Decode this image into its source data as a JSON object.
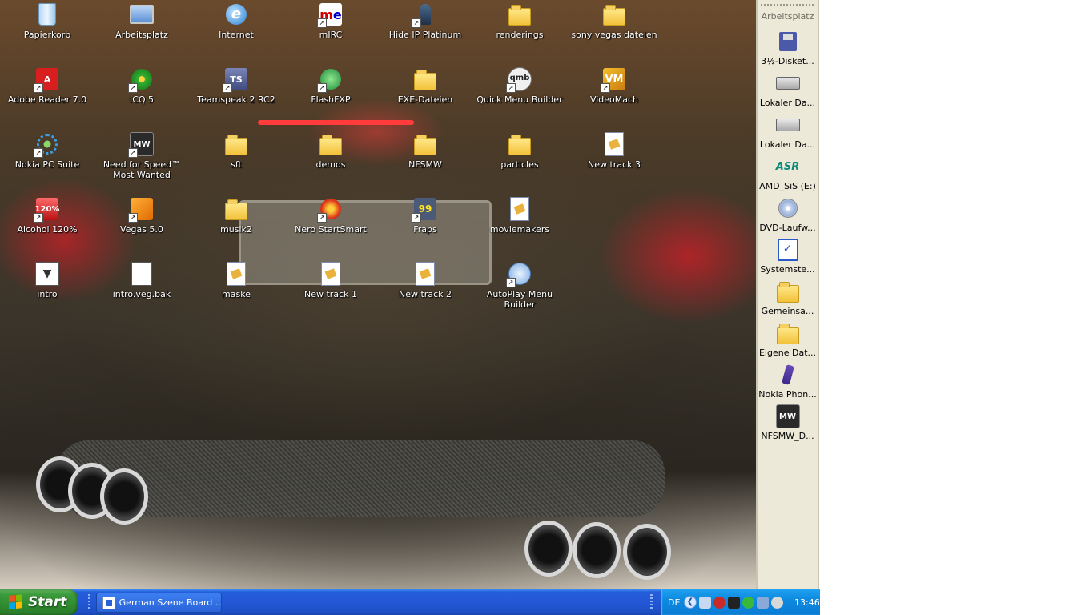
{
  "desktop": {
    "icons": [
      {
        "label": "Papierkorb",
        "icon": "recycle-bin-icon"
      },
      {
        "label": "Arbeitsplatz",
        "icon": "my-computer-icon"
      },
      {
        "label": "Internet",
        "icon": "internet-explorer-icon"
      },
      {
        "label": "mIRC",
        "icon": "mirc-icon"
      },
      {
        "label": "Hide IP Platinum",
        "icon": "hide-ip-icon"
      },
      {
        "label": "renderings",
        "icon": "folder-icon"
      },
      {
        "label": "sony vegas dateien",
        "icon": "folder-icon"
      },
      {
        "label": "Adobe Reader 7.0",
        "icon": "adobe-reader-icon"
      },
      {
        "label": "ICQ 5",
        "icon": "icq-icon"
      },
      {
        "label": "Teamspeak 2 RC2",
        "icon": "teamspeak-icon"
      },
      {
        "label": "FlashFXP",
        "icon": "flashfxp-icon"
      },
      {
        "label": "EXE-Dateien",
        "icon": "folder-icon"
      },
      {
        "label": "Quick Menu Builder",
        "icon": "quick-menu-builder-icon"
      },
      {
        "label": "VideoMach",
        "icon": "videomach-icon"
      },
      {
        "label": "Nokia PC Suite",
        "icon": "nokia-pc-suite-icon"
      },
      {
        "label": "Need for Speed™ Most Wanted",
        "icon": "nfs-most-wanted-icon"
      },
      {
        "label": "sft",
        "icon": "folder-icon"
      },
      {
        "label": "demos",
        "icon": "folder-icon"
      },
      {
        "label": "NFSMW",
        "icon": "folder-icon"
      },
      {
        "label": "particles",
        "icon": "folder-icon"
      },
      {
        "label": "New track 3",
        "icon": "audio-file-icon"
      },
      {
        "label": "Alcohol 120%",
        "icon": "alcohol-120-icon"
      },
      {
        "label": "Vegas 5.0",
        "icon": "vegas-icon"
      },
      {
        "label": "musik2",
        "icon": "folder-icon"
      },
      {
        "label": "Nero StartSmart",
        "icon": "nero-icon"
      },
      {
        "label": "Fraps",
        "icon": "fraps-icon"
      },
      {
        "label": "moviemakers",
        "icon": "document-icon"
      },
      {
        "label": "intro",
        "icon": "video-file-icon"
      },
      {
        "label": "intro.veg.bak",
        "icon": "vegas-project-icon"
      },
      {
        "label": "maske",
        "icon": "audio-file-icon"
      },
      {
        "label": "New track 1",
        "icon": "audio-file-icon"
      },
      {
        "label": "New track 2",
        "icon": "audio-file-icon"
      },
      {
        "label": "AutoPlay Menu Builder",
        "icon": "autoplay-icon"
      }
    ]
  },
  "sidebar": {
    "title": "Arbeitsplatz",
    "items": [
      {
        "label": "3½-Disket...",
        "icon": "floppy-drive-icon"
      },
      {
        "label": "Lokaler Da...",
        "icon": "hard-drive-icon"
      },
      {
        "label": "Lokaler Da...",
        "icon": "hard-drive-icon"
      },
      {
        "label": "AMD_SiS (E:)",
        "icon": "asr-drive-icon"
      },
      {
        "label": "DVD-Laufw...",
        "icon": "dvd-drive-icon"
      },
      {
        "label": "Systemste...",
        "icon": "control-panel-icon"
      },
      {
        "label": "Gemeinsa...",
        "icon": "folder-icon"
      },
      {
        "label": "Eigene Dat...",
        "icon": "folder-icon"
      },
      {
        "label": "Nokia Phon...",
        "icon": "nokia-phone-icon"
      },
      {
        "label": "NFSMW_D...",
        "icon": "nfs-most-wanted-icon"
      }
    ]
  },
  "taskbar": {
    "start_label": "Start",
    "task_label": "German Szene Board ...",
    "language": "DE",
    "clock": "13:46"
  },
  "colors": {
    "taskbar": "#245edb",
    "start": "#3c9b3c",
    "tray": "#0d8ae0",
    "sidebar": "#ece9d8"
  }
}
